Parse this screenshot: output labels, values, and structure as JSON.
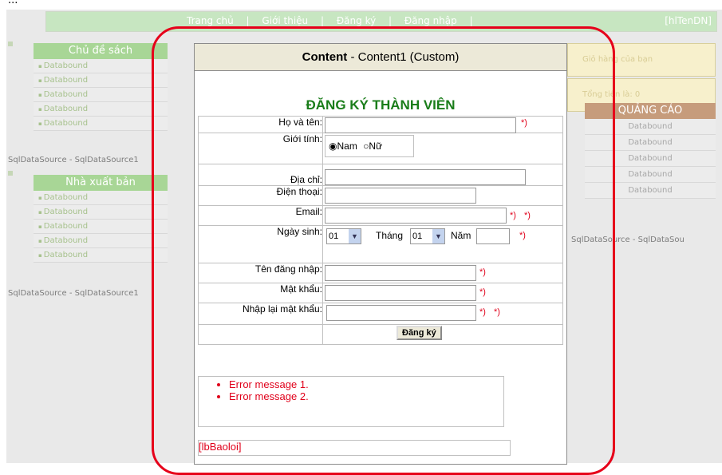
{
  "clipped_text": "...                                                            ",
  "topbar": {
    "nav": [
      "Trang chủ",
      "|",
      "Giới thiệu",
      "|",
      "Đăng ký",
      "|",
      "Đăng nhập",
      "|"
    ],
    "user_label": "[hlTenDN]"
  },
  "left": {
    "topic_header": "Chủ đề sách",
    "topic_items": [
      "Databound",
      "Databound",
      "Databound",
      "Databound",
      "Databound"
    ],
    "sqlds1": "SqlDataSource - SqlDataSource1",
    "publisher_header": "Nhà xuất bản",
    "publisher_items": [
      "Databound",
      "Databound",
      "Databound",
      "Databound",
      "Databound"
    ],
    "sqlds2": "SqlDataSource - SqlDataSource1"
  },
  "content": {
    "header_bold": "Content",
    "header_rest": " - Content1 (Custom)",
    "title": "ĐĂNG KÝ THÀNH VIÊN",
    "labels": {
      "name": "Họ và tên:",
      "gender": "Giới tính:",
      "address": "Địa chỉ:",
      "phone": "Điện thoại:",
      "email": "Email:",
      "birthday": "Ngày sinh:",
      "username": "Tên đăng nhập:",
      "password": "Mật khẩu:",
      "password_confirm": "Nhập lại mật khẩu:"
    },
    "gender_options": {
      "male": "Nam",
      "female": "Nữ"
    },
    "birthday": {
      "day_value": "01",
      "month_label": "Tháng",
      "month_value": "01",
      "year_label": "Năm"
    },
    "required_mark": "*)",
    "submit_label": "Đăng ký",
    "errors": [
      "Error message 1.",
      "Error message 2."
    ],
    "error_label": "[lbBaoloi]"
  },
  "right": {
    "cart_label": "Giỏ hàng của bạn",
    "total_label": "Tổng tiền là: 0",
    "ads_header": "QUẢNG CÁO",
    "ads_items": [
      "Databound",
      "Databound",
      "Databound",
      "Databound",
      "Databound"
    ],
    "sqlds": "SqlDataSource - SqlDataSou"
  },
  "colors": {
    "highlight_frame": "#e6001a",
    "title_green": "#1a7d1a",
    "error_red": "#e0001a"
  }
}
